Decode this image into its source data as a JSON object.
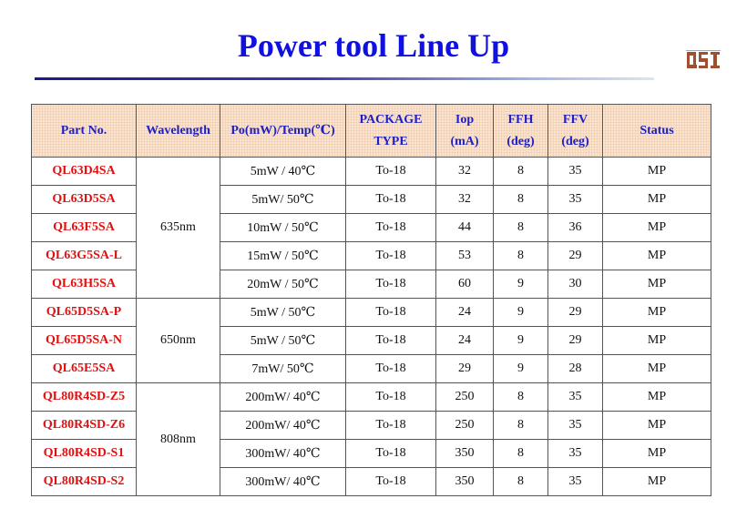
{
  "title": "Power tool Line Up",
  "logo": {
    "text": "QSI",
    "color": "#a05030"
  },
  "table": {
    "headers": {
      "part_no": "Part No.",
      "wavelength": "Wavelength",
      "po_temp": "Po(mW)/Temp(℃)",
      "package_1": "PACKAGE",
      "package_2": "TYPE",
      "iop_1": "Iop",
      "iop_2": "(mA)",
      "ffh_1": "FFH",
      "ffh_2": "(deg)",
      "ffv_1": "FFV",
      "ffv_2": "(deg)",
      "status": "Status"
    },
    "rows": [
      {
        "part": "QL63D4SA",
        "wavelength": "635nm",
        "po": "5mW / 40℃",
        "pkg": "To-18",
        "iop": "32",
        "ffh": "8",
        "ffv": "35",
        "status": "MP"
      },
      {
        "part": "QL63D5SA",
        "wavelength": "635nm",
        "po": "5mW/ 50℃",
        "pkg": "To-18",
        "iop": "32",
        "ffh": "8",
        "ffv": "35",
        "status": "MP"
      },
      {
        "part": "QL63F5SA",
        "wavelength": "635nm",
        "po": "10mW / 50℃",
        "pkg": "To-18",
        "iop": "44",
        "ffh": "8",
        "ffv": "36",
        "status": "MP"
      },
      {
        "part": "QL63G5SA-L",
        "wavelength": "635nm",
        "po": "15mW / 50℃",
        "pkg": "To-18",
        "iop": "53",
        "ffh": "8",
        "ffv": "29",
        "status": "MP"
      },
      {
        "part": "QL63H5SA",
        "wavelength": "635nm",
        "po": "20mW / 50℃",
        "pkg": "To-18",
        "iop": "60",
        "ffh": "9",
        "ffv": "30",
        "status": "MP"
      },
      {
        "part": "QL65D5SA-P",
        "wavelength": "650nm",
        "po": "5mW / 50℃",
        "pkg": "To-18",
        "iop": "24",
        "ffh": "9",
        "ffv": "29",
        "status": "MP"
      },
      {
        "part": "QL65D5SA-N",
        "wavelength": "650nm",
        "po": "5mW / 50℃",
        "pkg": "To-18",
        "iop": "24",
        "ffh": "9",
        "ffv": "29",
        "status": "MP"
      },
      {
        "part": "QL65E5SA",
        "wavelength": "650nm",
        "po": "7mW/ 50℃",
        "pkg": "To-18",
        "iop": "29",
        "ffh": "9",
        "ffv": "28",
        "status": "MP"
      },
      {
        "part": "QL80R4SD-Z5",
        "wavelength": "808nm",
        "po": "200mW/ 40℃",
        "pkg": "To-18",
        "iop": "250",
        "ffh": "8",
        "ffv": "35",
        "status": "MP"
      },
      {
        "part": "QL80R4SD-Z6",
        "wavelength": "808nm",
        "po": "200mW/ 40℃",
        "pkg": "To-18",
        "iop": "250",
        "ffh": "8",
        "ffv": "35",
        "status": "MP"
      },
      {
        "part": "QL80R4SD-S1",
        "wavelength": "808nm",
        "po": "300mW/ 40℃",
        "pkg": "To-18",
        "iop": "350",
        "ffh": "8",
        "ffv": "35",
        "status": "MP"
      },
      {
        "part": "QL80R4SD-S2",
        "wavelength": "808nm",
        "po": "300mW/ 40℃",
        "pkg": "To-18",
        "iop": "350",
        "ffh": "8",
        "ffv": "35",
        "status": "MP"
      }
    ]
  }
}
